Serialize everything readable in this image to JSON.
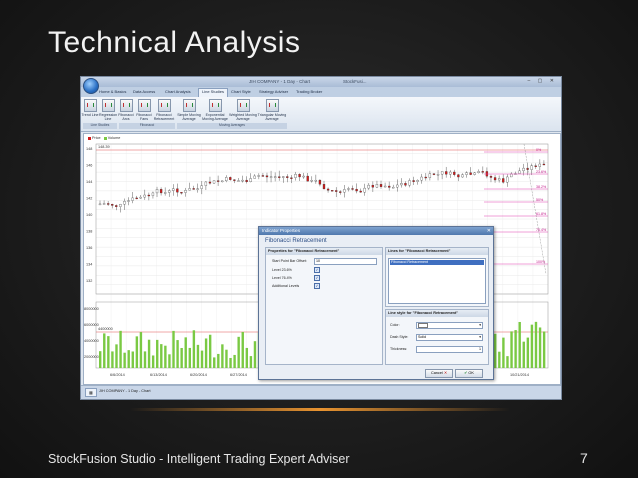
{
  "slide": {
    "title": "Technical Analysis",
    "footer": "StockFusion Studio - Intelligent Trading Expert Adviser",
    "page_number": "7"
  },
  "app": {
    "window_title": "JIH COMPANY - 1 Day - Chart",
    "title_suffix": "StockFusi...",
    "tabs": [
      "Home & Basics",
      "Data Access",
      "Chart Analysis",
      "Line Studies",
      "Chart Style",
      "Strategy Adviser",
      "Trading Broker"
    ],
    "active_tab": "Line Studies",
    "ribbon_buttons": [
      {
        "label": "Trend Line"
      },
      {
        "label": "Regression Line"
      },
      {
        "label": "Fibonacci Arcs"
      },
      {
        "label": "Fibonacci Fans"
      },
      {
        "label": "Fibonacci Retracement"
      },
      {
        "label": "Simple Moving Average"
      },
      {
        "label": "Exponential Moving Average"
      },
      {
        "label": "Weighted Moving Average"
      },
      {
        "label": "Triangular Moving Average"
      }
    ],
    "ribbon_groups": [
      "Line Studies",
      "Fibonacci",
      "Moving Averages"
    ],
    "legend": {
      "price": "Price",
      "volume": "Volume"
    },
    "price_axis": [
      "148",
      "146",
      "144",
      "142",
      "140",
      "138",
      "136",
      "134",
      "132"
    ],
    "price_marker": "148.39",
    "volume_axis": [
      "8000000",
      "6000000",
      "4000000",
      "2000000"
    ],
    "volume_marker": "4400000",
    "date_axis": [
      "6/6/2014",
      "6/13/2014",
      "6/20/2014",
      "6/27/2014",
      "7/7/2014",
      "7/14/2014",
      "7/21/2014",
      "7/28/2014",
      "10/7/2014",
      "10/14/2014",
      "10/21/2014"
    ],
    "fib_levels": [
      "0%",
      "23.6%",
      "38.2%",
      "50%",
      "61.8%",
      "76.4%",
      "100%"
    ],
    "doc_tab": "JIH COMPANY - 1 Day - Chart",
    "colors": {
      "up": "#ffffff",
      "down": "#d01a1a",
      "volume": "#7ac943",
      "fib": "#e040b0",
      "accent": "#2e4f86"
    }
  },
  "dialog": {
    "title": "Indicator Properties",
    "heading": "Fibonacci Retracement",
    "properties_header": "Properties for \"Fibonacci Retracement\"",
    "lines_header": "Lines for \"Fibonacci Retracement\"",
    "start_label": "Start Point Bar Offset:",
    "start_value": "10",
    "level1_label": "Level 23.6%",
    "level2_label": "Level 76.4%",
    "additional_label": "Additional Levels",
    "lines_selected": "Fibonacci Retracement",
    "line_style_header": "Line style for \"Fibonacci Retracement\"",
    "color_label": "Color:",
    "dash_label": "Dash Style:",
    "dash_value": "Solid",
    "thickness_label": "Thickness:",
    "thickness_value": "1",
    "cancel": "Cancel",
    "ok": "OK"
  }
}
